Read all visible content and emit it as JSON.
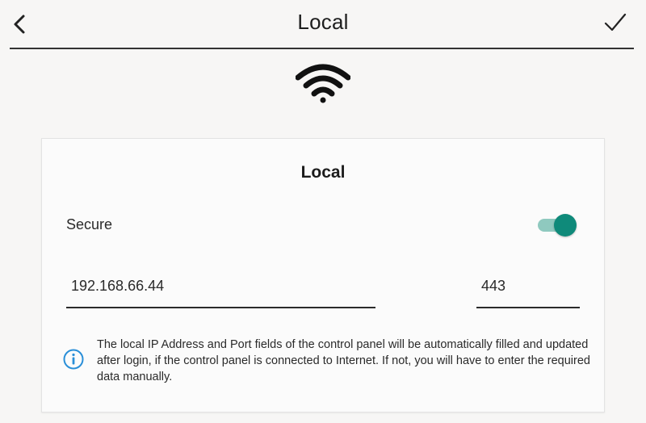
{
  "header": {
    "title": "Local",
    "back_icon": "chevron-left-icon",
    "confirm_icon": "checkmark-icon"
  },
  "status_icon": "wifi-icon",
  "card": {
    "title": "Local",
    "secure": {
      "label": "Secure",
      "enabled": true
    },
    "ip_field": {
      "value": "192.168.66.44"
    },
    "port_field": {
      "value": "443"
    },
    "info": {
      "icon": "info-icon",
      "text": "The local IP Address and Port fields of the control panel will be automatically filled and updated after login, if the control panel is connected to Internet. If not, you will have to enter the required data manually."
    }
  },
  "colors": {
    "background": "#f7f6f5",
    "toggle_thumb": "#0f8a7a",
    "toggle_track": "#8fc9bf",
    "info_icon": "#2a8fd8"
  }
}
